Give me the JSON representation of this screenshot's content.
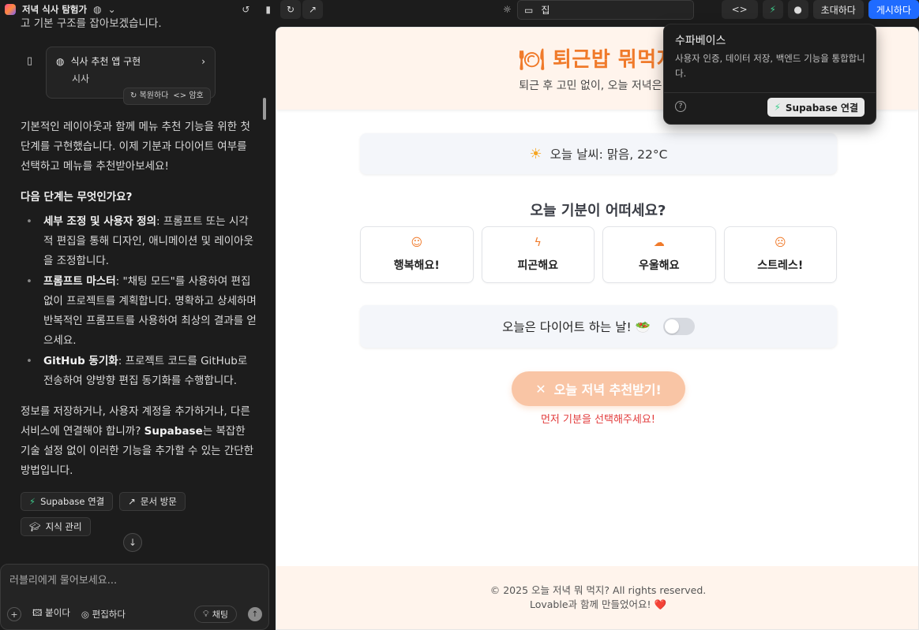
{
  "app": {
    "project_title": "저녁 식사 탐험가"
  },
  "chat": {
    "fragment": "고 기본 구조를 잡아보겠습니다.",
    "card": {
      "title": "식사 추천 앱 구현",
      "subtitle": "시사",
      "restore_label": "복원하다",
      "code_label": "암호"
    },
    "message1": "기본적인 레이아웃과 함께 메뉴 추천 기능을 위한 첫 단계를 구현했습니다. 이제 기분과 다이어트 여부를 선택하고 메뉴를 추천받아보세요!",
    "next_heading": "다음 단계는 무엇인가요?",
    "bullets": [
      {
        "title": "세부 조정 및 사용자 정의",
        "text": ": 프롬프트 또는 시각적 편집을 통해 디자인, 애니메이션 및 레이아웃을 조정합니다."
      },
      {
        "title": "프롬프트 마스터",
        "text": ": \"채팅 모드\"를 사용하여 편집 없이 프로젝트를 계획합니다. 명확하고 상세하며 반복적인 프롬프트를 사용하여 최상의 결과를 얻으세요."
      },
      {
        "title": "GitHub 동기화",
        "text": ": 프로젝트 코드를 GitHub로 전송하여 양방향 편집 동기화를 수행합니다."
      }
    ],
    "message2_pre": "정보를 저장하거나, 사용자 계정을 추가하거나, 다른 서비스에 연결해야 합니까? ",
    "message2_bold": "Supabase",
    "message2_post": "는 복잡한 기술 설정 없이 이러한 기능을 추가할 수 있는 간단한 방법입니다.",
    "actions": {
      "supabase": "Supabase 연결",
      "docs": "문서 방문",
      "knowledge": "지식 관리"
    }
  },
  "composer": {
    "placeholder": "러블리에게 물어보세요...",
    "attach": "붙이다",
    "edit": "편집하다",
    "chat": "채팅"
  },
  "toolbar": {
    "url_path": "집",
    "invite": "초대하다",
    "publish": "게시하다"
  },
  "popover": {
    "title": "수파베이스",
    "description": "사용자 인증, 데이터 저장, 백엔드 기능을 통합합니다.",
    "button": "Supabase 연결"
  },
  "preview": {
    "title": "퇴근밥 뭐먹지",
    "subtitle": "퇴근 후 고민 없이, 오늘 저녁은 이",
    "weather": "오늘 날씨: 맑음, 22°C",
    "mood_question": "오늘 기분이 어떠세요?",
    "moods": [
      "행복해요!",
      "피곤해요",
      "우울해요",
      "스트레스!"
    ],
    "diet_label": "오늘은 다이어트 하는 날! 🥗",
    "recommend_button": "오늘 저녁 추천받기!",
    "warning": "먼저 기분을 선택해주세요!",
    "footer_line1": "© 2025 오늘 저녁 뭐 먹지? All rights reserved.",
    "footer_line2": "Lovable과 함께 만들었어요! ❤️"
  },
  "colors": {
    "accent_orange": "#f07a2a",
    "publish_blue": "#1f6bff",
    "supabase_green": "#3ecf8e",
    "warning_red": "#e23b3b"
  }
}
